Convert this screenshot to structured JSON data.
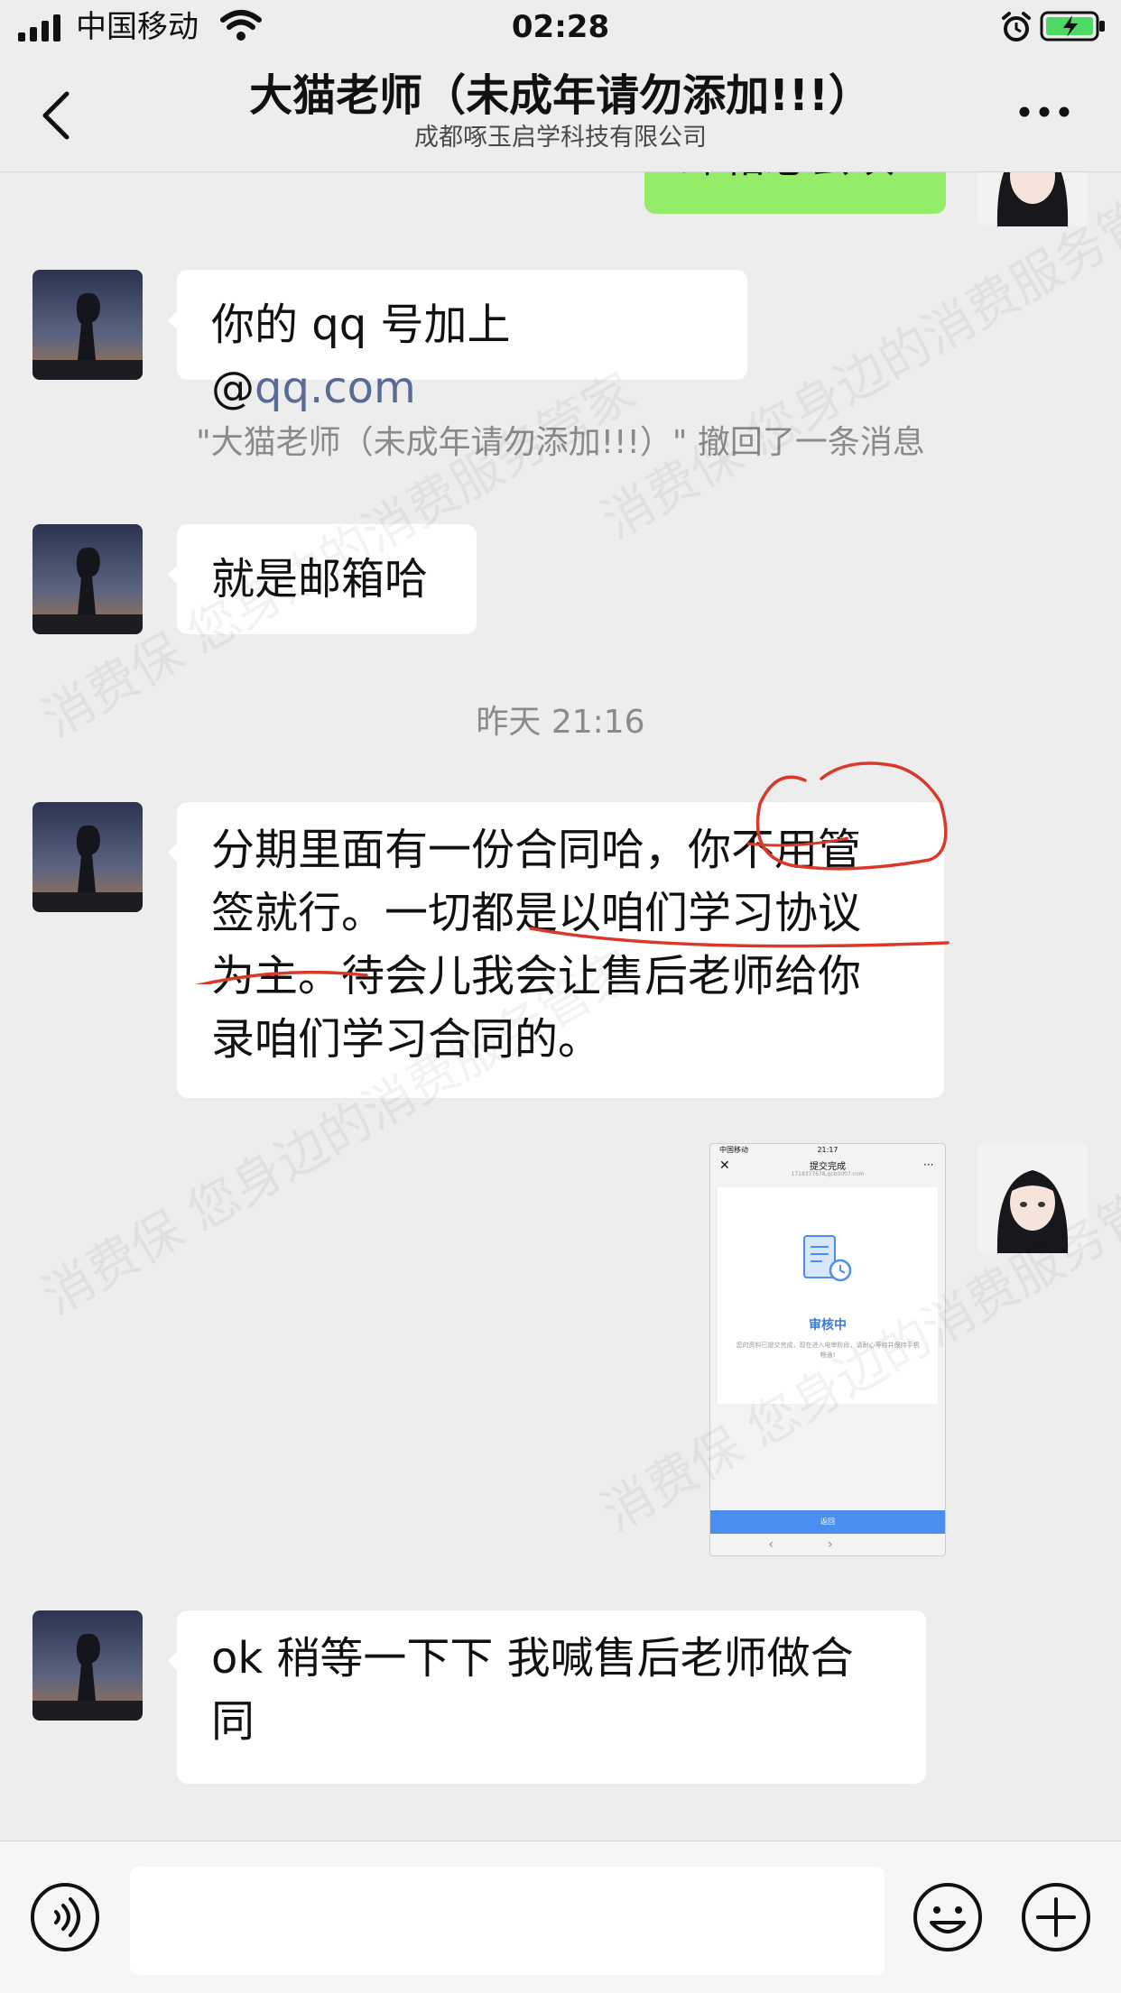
{
  "status_bar": {
    "carrier": "中国移动",
    "time": "02:28"
  },
  "header": {
    "title": "大猫老师（未成年请勿添加!!!）",
    "subtitle": "成都啄玉启学科技有限公司"
  },
  "messages": [
    {
      "side": "right",
      "text": "邮箱必会填"
    },
    {
      "side": "left",
      "text_prefix": "你的 qq 号加上 @",
      "link": "qq.com"
    },
    {
      "type": "system",
      "text": "\"大猫老师（未成年请勿添加!!!）\" 撤回了一条消息"
    },
    {
      "side": "left",
      "text": "就是邮箱哈"
    },
    {
      "type": "time",
      "text": "昨天 21:16"
    },
    {
      "side": "left",
      "lines": [
        "分期里面有一份合同哈，你不用管",
        "签就行。一切都是以咱们学习协议",
        "为主。待会儿我会让售后老师给你",
        "录咱们学习合同的。"
      ]
    },
    {
      "side": "right",
      "type": "image",
      "screenshot": {
        "carrier": "中国移动",
        "time": "21:17",
        "title": "提交完成",
        "url": "1718377678.qcb0007.com",
        "status": "审核中",
        "desc": "您的资料已提交完成，现在进入电审阶段，请耐心等待并保持手机畅通!",
        "button": "返回"
      }
    },
    {
      "side": "left",
      "lines": [
        "ok 稍等一下下 我喊售后老师做合",
        "同"
      ]
    }
  ],
  "watermark": [
    "消费保 您身边的消费服务管家",
    "您身边的消费保"
  ],
  "colors": {
    "bubble_self": "#95ec69",
    "bubble_other": "#ffffff",
    "link": "#576b95",
    "background": "#ededed",
    "annotation": "#d9392b"
  }
}
